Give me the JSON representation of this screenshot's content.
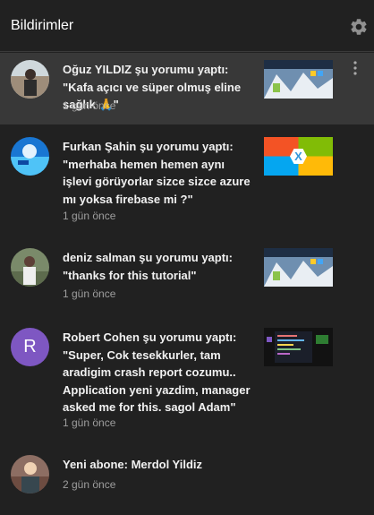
{
  "header": {
    "title": "Bildirimler",
    "settings_icon": "gear-icon"
  },
  "colors": {
    "background": "#212121",
    "highlight": "#383838",
    "meta": "#9e9e9e",
    "letter_avatar": "#7e57c2"
  },
  "notifications": [
    {
      "text": "Oğuz YILDIZ şu yorumu yaptı: \"Kafa açıcı ve süper olmuş eline sağlık 🙏\"",
      "time": "1 gün önce",
      "thumbnail": "video-thumbnail-firebase"
    },
    {
      "text": "Furkan Şahin şu yorumu yaptı: \"merhaba hemen hemen aynı işlevi görüyorlar sizce sizce azure mı yoksa firebase mi ?\"",
      "time": "1 gün önce",
      "thumbnail": "video-thumbnail-xamarin"
    },
    {
      "text": "deniz salman şu yorumu yaptı: \"thanks for this tutorial\"",
      "time": "1 gün önce",
      "thumbnail": "video-thumbnail-firebase"
    },
    {
      "text": "Robert Cohen şu yorumu yaptı: \"Super, Cok tesekkurler, tam aradigim crash report cozumu.. Application yeni yazdim, manager asked me for this. sagol Adam\"",
      "time": "1 gün önce",
      "thumbnail": "video-thumbnail-code",
      "avatar_letter": "R"
    },
    {
      "text": "Yeni abone: Merdol Yildiz",
      "time": "2 gün önce"
    }
  ]
}
